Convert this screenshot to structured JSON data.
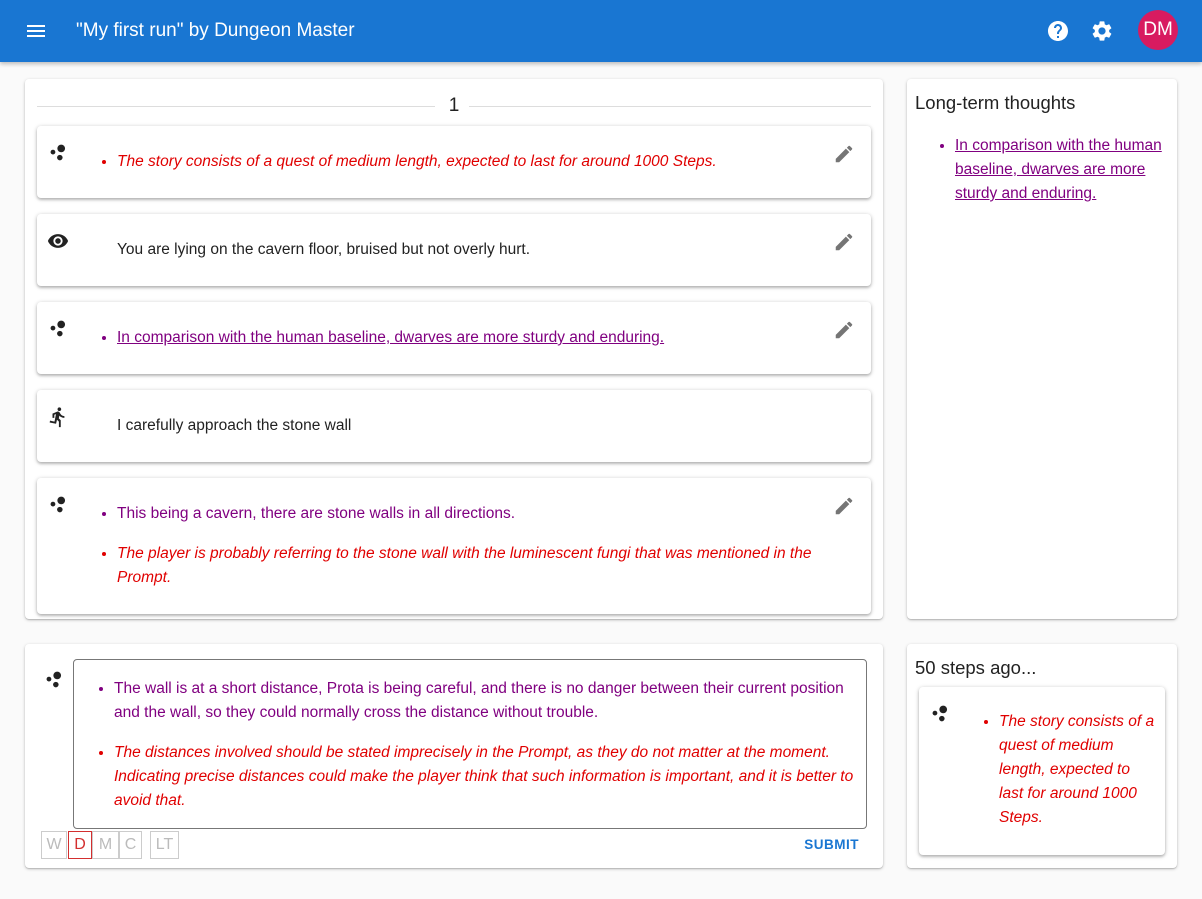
{
  "header": {
    "title": "\"My first run\" by Dungeon Master",
    "avatar_initials": "DM",
    "menu_icon": "menu-icon",
    "help_icon": "help-icon",
    "settings_icon": "gear-icon",
    "background_color": "#1976d2",
    "avatar_color": "#d81b60"
  },
  "step_panel": {
    "step_number": "1",
    "cards": [
      {
        "kind": "thought",
        "icon": "thought-bubbles-icon",
        "editable": true,
        "items": [
          {
            "text": "The story consists of a quest of medium length, expected to last for around 1000 Steps.",
            "style": "red-italic"
          }
        ]
      },
      {
        "kind": "observation",
        "icon": "eye-icon",
        "editable": true,
        "text": "You are lying on the cavern floor, bruised but not overly hurt."
      },
      {
        "kind": "thought",
        "icon": "thought-bubbles-icon",
        "editable": true,
        "items": [
          {
            "text": "In comparison with the human baseline, dwarves are more sturdy and enduring.",
            "style": "link"
          }
        ]
      },
      {
        "kind": "action",
        "icon": "walking-person-icon",
        "editable": false,
        "text": "I carefully approach the stone wall"
      },
      {
        "kind": "thought",
        "icon": "thought-bubbles-icon",
        "editable": true,
        "items": [
          {
            "text": "This being a cavern, there are stone walls in all directions.",
            "style": "purple"
          },
          {
            "text": "The player is probably referring to the stone wall with the luminescent fungi that was mentioned in the Prompt.",
            "style": "red-italic"
          }
        ]
      }
    ]
  },
  "long_term": {
    "title": "Long-term thoughts",
    "items": [
      "In comparison with the human baseline, dwarves are more sturdy and enduring."
    ]
  },
  "composer": {
    "icon": "thought-bubbles-icon",
    "items": [
      {
        "text": "The wall is at a short distance, Prota is being careful, and there is no danger between their current position and the wall, so they could normally cross the distance without trouble.",
        "style": "purple"
      },
      {
        "text": "The distances involved should be stated imprecisely in the Prompt, as they do not matter at the moment. Indicating precise distances could make the player think that such information is important, and it is better to avoid that.",
        "style": "red-italic"
      }
    ],
    "chips": [
      {
        "label": "W",
        "active": false
      },
      {
        "label": "D",
        "active": true
      },
      {
        "label": "M",
        "active": false
      },
      {
        "label": "C",
        "active": false
      },
      {
        "label": "LT",
        "active": false
      }
    ],
    "submit_label": "SUBMIT"
  },
  "history": {
    "title": "50 steps ago...",
    "icon": "thought-bubbles-icon",
    "items": [
      {
        "text": "The story consists of a quest of medium length, expected to last for around 1000 Steps.",
        "style": "red-italic"
      }
    ]
  }
}
